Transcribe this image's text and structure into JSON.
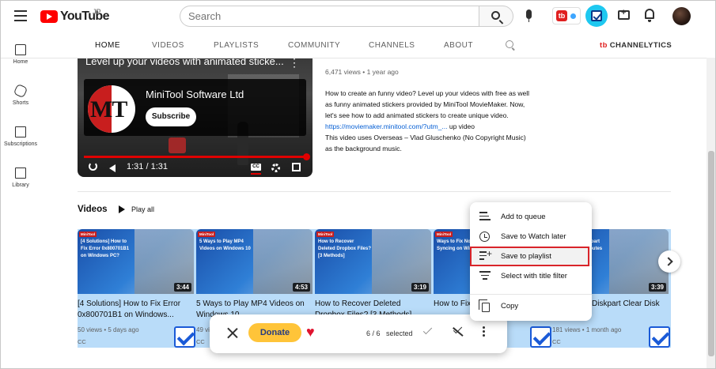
{
  "header": {
    "logo_text": "YouTube",
    "region": "JP",
    "search_placeholder": "Search"
  },
  "sidebar": {
    "items": [
      {
        "label": "Home",
        "icon": "home-icon"
      },
      {
        "label": "Shorts",
        "icon": "shorts-icon"
      },
      {
        "label": "Subscriptions",
        "icon": "subscriptions-icon"
      },
      {
        "label": "Library",
        "icon": "library-icon"
      }
    ]
  },
  "channel_tabs": {
    "items": [
      "HOME",
      "VIDEOS",
      "PLAYLISTS",
      "COMMUNITY",
      "CHANNELS",
      "ABOUT"
    ],
    "active": "HOME",
    "extension_label": "CHANNELYTICS",
    "extension_badge": "tb"
  },
  "player": {
    "title": "Level up your videos with animated sticke...",
    "channel_name": "MiniTool Software Ltd",
    "channel_logo_text": "MT",
    "subscribe_label": "Subscribe",
    "time": "1:31 / 1:31",
    "cc_label": "CC",
    "progress": 1.0
  },
  "description": {
    "meta": "6,471 views • 1 year ago",
    "lines": [
      "How to create an funny video? Level up your videos with free as well",
      "as funny animated stickers provided by MiniTool MovieMaker. Now,",
      "let's see how to add animated stickers to create unique video.",
      "up video",
      "This video uses Overseas – Vlad Gluschenko (No Copyright Music)",
      "as the background music."
    ],
    "link": "https://moviemaker.minitool.com/?utm_..."
  },
  "videos_section": {
    "title": "Videos",
    "play_all": "Play all",
    "cards": [
      {
        "thumb_text": "[4 Solutions] How to Fix Error 0x800701B1 on Windows PC?",
        "brand": "MiniTool",
        "duration": "3:44",
        "title": "[4 Solutions] How to Fix Error 0x800701B1 on Windows...",
        "meta": "50 views • 5 days ago",
        "cc": "CC",
        "checked": true
      },
      {
        "thumb_text": "5 Ways to Play MP4 Videos on Windows 10",
        "brand": "MiniTool",
        "duration": "4:53",
        "title": "5 Ways to Play MP4 Videos on Windows 10",
        "meta": "49 views • 1 week ago",
        "cc": "CC",
        "checked": true
      },
      {
        "thumb_text": "How to Recover Deleted Dropbox Files? [3 Methods]",
        "brand": "MiniTool",
        "duration": "3:19",
        "title": "How to Recover Deleted Dropbox Files? [3 Methods]",
        "meta": "",
        "cc": "",
        "checked": true
      },
      {
        "thumb_text": "Ways to Fix Not Syncing on Windows",
        "brand": "MiniTool",
        "duration": "",
        "title": "How to Fix",
        "meta": "",
        "cc": "",
        "checked": true
      },
      {
        "thumb_text": "How to Fix Diskpart Clear Disk Attributes",
        "brand": "MiniTool",
        "duration": "3:39",
        "title": "How to Fix Diskpart Clear Disk Attributes",
        "meta": "181 views • 1 month ago",
        "cc": "CC",
        "checked": true
      }
    ]
  },
  "bulk_bar": {
    "donate_label": "Donate",
    "selected_count": "6 / 6",
    "selected_label": "selected"
  },
  "context_menu": {
    "items": [
      {
        "label": "Add to queue",
        "icon": "queue-icon"
      },
      {
        "label": "Save to Watch later",
        "icon": "clock-icon"
      },
      {
        "label": "Save to playlist",
        "icon": "playlist-add-icon",
        "highlighted": true
      },
      {
        "label": "Select with title filter",
        "icon": "filter-icon"
      },
      {
        "label": "Copy",
        "icon": "copy-icon"
      }
    ]
  },
  "colors": {
    "brand_red": "#ff0000",
    "selection_blue": "#b9dcf9",
    "check_blue": "#1a5ad7",
    "donate_yellow": "#ffc439",
    "highlight_border": "#d9242a",
    "link_blue": "#065fd4"
  }
}
